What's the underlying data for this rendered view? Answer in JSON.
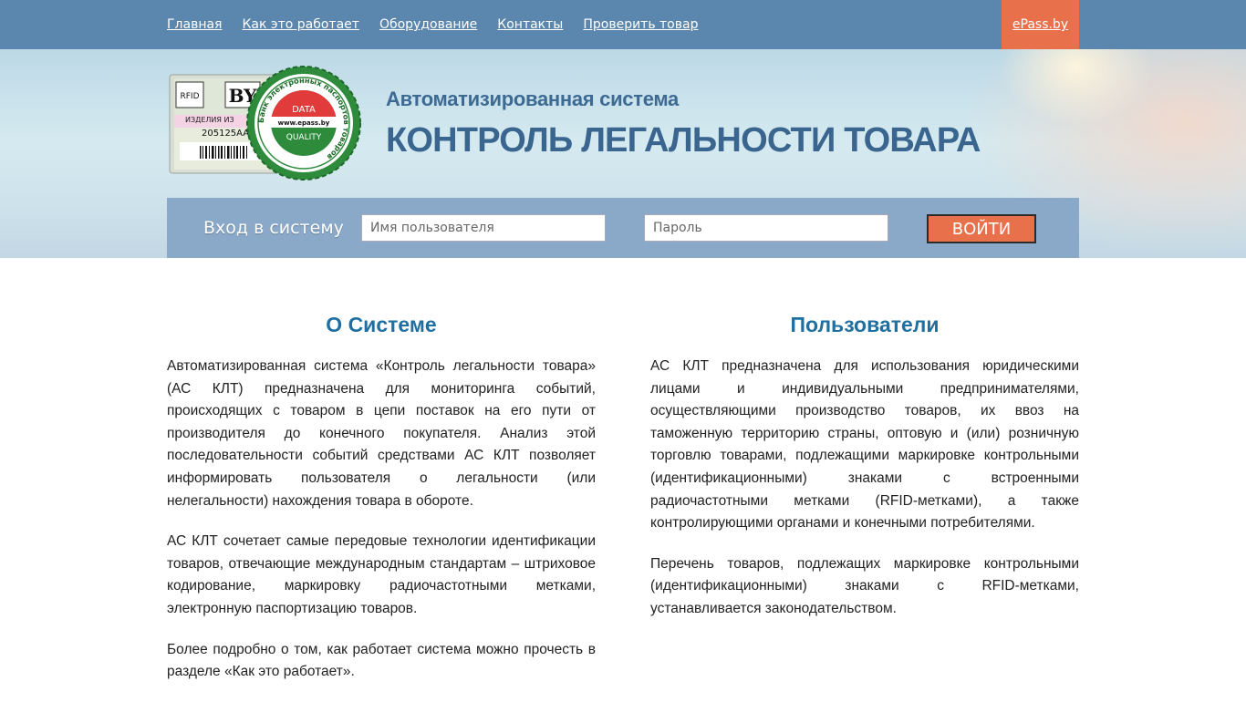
{
  "nav": {
    "items": [
      "Главная",
      "Как это работает",
      "Оборудование",
      "Контакты",
      "Проверить товар"
    ],
    "external_link": "ePass.by"
  },
  "header": {
    "logo": {
      "label_rfid": "RFID",
      "label_country": "BY",
      "label_product": "ИЗДЕЛИЯ ИЗ",
      "serial": "205125AA0",
      "seal_text": "Банк электронных паспортов товаров",
      "seal_url": "www.epass.by",
      "seal_top": "DATA",
      "seal_bottom": "QUALITY"
    },
    "subtitle": "Автоматизированная система",
    "title": "КОНТРОЛЬ ЛЕГАЛЬНОСТИ ТОВАРА"
  },
  "login": {
    "label": "Вход в систему",
    "username_placeholder": "Имя пользователя",
    "password_placeholder": "Пароль",
    "submit_label": "ВОЙТИ"
  },
  "about": {
    "title": "О Системе",
    "paragraphs": [
      "Автоматизированная система «Контроль легальности товара» (АС КЛТ) предназначена для мониторинга событий, происходящих с товаром в цепи поставок на его пути от производителя до конечного покупателя. Анализ этой последовательности событий средствами АС КЛТ позволяет информировать пользователя о легальности (или нелегальности) нахождения товара в обороте.",
      "АС КЛТ сочетает самые передовые технологии идентификации товаров, отвечающие международным стандартам – штриховое кодирование, маркировку радиочастотными метками, электронную паспортизацию товаров.",
      "Более подробно о том, как работает система можно прочесть в разделе «Как это работает»."
    ]
  },
  "users": {
    "title": "Пользователи",
    "paragraphs": [
      "АС КЛТ предназначена для использования юридическими лицами и индивидуальными предпринимателями, осуществляющими производство товаров, их ввоз на таможенную территорию страны, оптовую и (или) розничную торговлю товарами, подлежащими маркировке контрольными (идентификационными) знаками с встроенными радиочастотными метками (RFID-метками), а также контролирующими органами и конечными потребителями.",
      "Перечень товаров, подлежащих маркировке контрольными (идентификационными) знаками с RFID-метками, устанавливается законодательством."
    ]
  },
  "colors": {
    "topbar": "#5b86ad",
    "accent": "#e8704a",
    "title": "#3a658f",
    "heading": "#1f6fa0",
    "loginbar": "#8aa9c8"
  }
}
